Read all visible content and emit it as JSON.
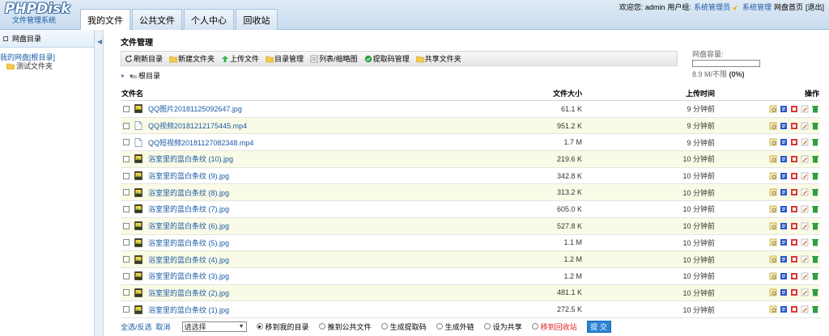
{
  "app": {
    "logo_main": "PHPDisk",
    "logo_sub": "文件管理系统"
  },
  "nav": {
    "tabs": [
      {
        "label": "我的文件",
        "active": true
      },
      {
        "label": "公共文件",
        "active": false
      },
      {
        "label": "个人中心",
        "active": false
      },
      {
        "label": "回收站",
        "active": false
      }
    ]
  },
  "top_links": {
    "welcome": "欢迎您: admin",
    "group_label": "用户组:",
    "group_value": "系统管理员",
    "admin_link": "系统管理",
    "home_link": "网盘首页",
    "logout": "[退出]"
  },
  "sidebar": {
    "title": "网盘目录",
    "root": "我的网盘[根目录]",
    "children": [
      "测试文件夹"
    ]
  },
  "main": {
    "title": "文件管理",
    "breadcrumb": "根目录",
    "toolbar": [
      {
        "label": "刷新目录",
        "icon": "refresh-icon"
      },
      {
        "label": "新建文件夹",
        "icon": "new-folder-icon"
      },
      {
        "label": "上传文件",
        "icon": "upload-icon"
      },
      {
        "label": "目录管理",
        "icon": "folder-manage-icon"
      },
      {
        "label": "列表/缩略图",
        "icon": "view-toggle-icon"
      },
      {
        "label": "提取码管理",
        "icon": "extract-code-icon"
      },
      {
        "label": "共享文件夹",
        "icon": "share-folder-icon"
      }
    ],
    "quota": {
      "label": "网盘容量:",
      "used": "8.9 M/不限",
      "percent": "(0%)",
      "fraction": 0
    }
  },
  "table": {
    "headers": {
      "name": "文件名",
      "size": "文件大小",
      "time": "上传时间",
      "ops": "操作"
    },
    "rows": [
      {
        "name": "QQ图片20181125092647.jpg",
        "size": "61.1 K",
        "time": "9 分钟前",
        "type": "image"
      },
      {
        "name": "QQ视频20181212175445.mp4",
        "size": "951.2 K",
        "time": "9 分钟前",
        "type": "file"
      },
      {
        "name": "QQ短视频20181127082348.mp4",
        "size": "1.7 M",
        "time": "9 分钟前",
        "type": "file"
      },
      {
        "name": "浴室里的蓝白条纹 (10).jpg",
        "size": "219.6 K",
        "time": "10 分钟前",
        "type": "image"
      },
      {
        "name": "浴室里的蓝白条纹 (9).jpg",
        "size": "342.8 K",
        "time": "10 分钟前",
        "type": "image"
      },
      {
        "name": "浴室里的蓝白条纹 (8).jpg",
        "size": "313.2 K",
        "time": "10 分钟前",
        "type": "image"
      },
      {
        "name": "浴室里的蓝白条纹 (7).jpg",
        "size": "605.0 K",
        "time": "10 分钟前",
        "type": "image"
      },
      {
        "name": "浴室里的蓝白条纹 (6).jpg",
        "size": "527.8 K",
        "time": "10 分钟前",
        "type": "image"
      },
      {
        "name": "浴室里的蓝白条纹 (5).jpg",
        "size": "1.1 M",
        "time": "10 分钟前",
        "type": "image"
      },
      {
        "name": "浴室里的蓝白条纹 (4).jpg",
        "size": "1.2 M",
        "time": "10 分钟前",
        "type": "image"
      },
      {
        "name": "浴室里的蓝白条纹 (3).jpg",
        "size": "1.2 M",
        "time": "10 分钟前",
        "type": "image"
      },
      {
        "name": "浴室里的蓝白条纹 (2).jpg",
        "size": "481.1 K",
        "time": "10 分钟前",
        "type": "image"
      },
      {
        "name": "浴室里的蓝白条纹 (1).jpg",
        "size": "272.5 K",
        "time": "10 分钟前",
        "type": "image"
      }
    ]
  },
  "footer": {
    "select_all": "全选/反选",
    "cancel": "取消",
    "select_value": "请选择",
    "options": [
      {
        "label": "移到我的目录",
        "checked": true,
        "red": false
      },
      {
        "label": "推到公共文件",
        "checked": false,
        "red": false
      },
      {
        "label": "生成提取码",
        "checked": false,
        "red": false
      },
      {
        "label": "生成外链",
        "checked": false,
        "red": false
      },
      {
        "label": "设为共享",
        "checked": false,
        "red": false
      },
      {
        "label": "移到回收站",
        "checked": false,
        "red": true
      }
    ],
    "submit": "提 交"
  },
  "colors": {
    "link": "#1a5aa5",
    "row_highlight": "#fafbe6",
    "submit": "#2b83d2",
    "danger": "#e02020"
  }
}
